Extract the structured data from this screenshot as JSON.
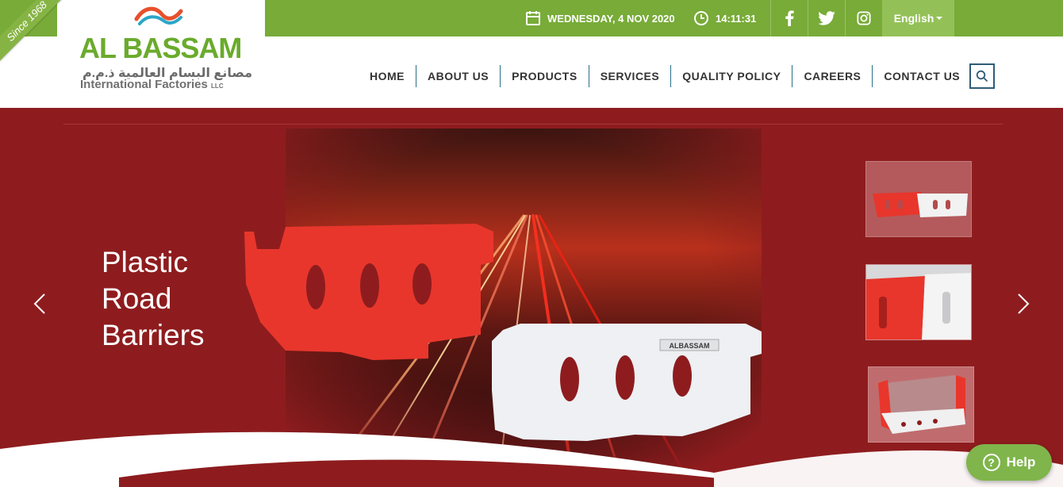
{
  "header": {
    "ribbon": "Since 1968",
    "logo_name": "AL BASSAM",
    "logo_arabic": "مصانع البسام العالمية ذ.م.م",
    "logo_sub": "International Factories",
    "logo_llc": "LLC",
    "date": "WEDNESDAY, 4 NOV 2020",
    "time": "14:11:31",
    "language": "English",
    "accent_color": "#78ab38"
  },
  "nav": {
    "items": [
      "HOME",
      "ABOUT US",
      "PRODUCTS",
      "SERVICES",
      "QUALITY POLICY",
      "CAREERS",
      "CONTACT US"
    ]
  },
  "hero": {
    "slide_title_line1": "Plastic",
    "slide_title_line2": "Road",
    "slide_title_line3": "Barriers",
    "barrier_label": "ALBASSAM",
    "background_color": "#8e1c1e"
  },
  "help": {
    "label": "Help"
  }
}
